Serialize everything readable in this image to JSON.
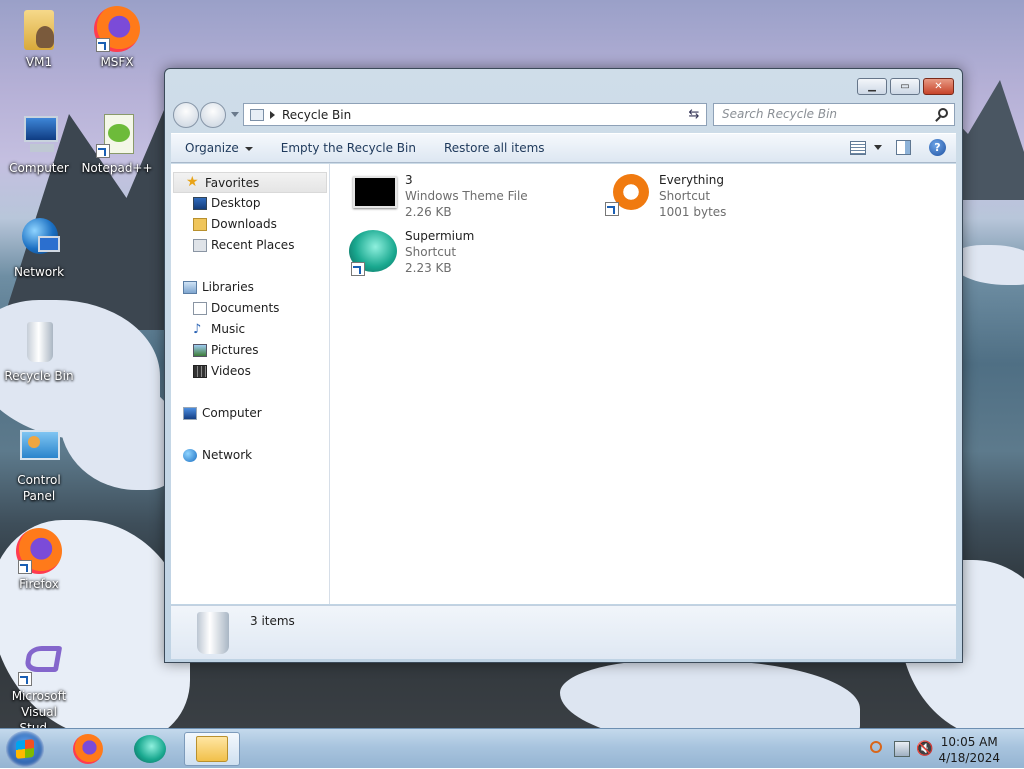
{
  "desktop": {
    "icons": [
      {
        "label": "VM1"
      },
      {
        "label": "MSFX"
      },
      {
        "label": "Computer"
      },
      {
        "label": "Notepad++"
      },
      {
        "label": "Network"
      },
      {
        "label": "Recycle Bin"
      },
      {
        "label": "Control Panel"
      },
      {
        "label": "Firefox"
      },
      {
        "label": "Microsoft Visual Stud..."
      }
    ]
  },
  "window": {
    "address": "Recycle Bin",
    "search_placeholder": "Search Recycle Bin",
    "toolbar": {
      "organize": "Organize",
      "empty": "Empty the Recycle Bin",
      "restore": "Restore all items"
    },
    "nav": {
      "favorites": "Favorites",
      "desktop": "Desktop",
      "downloads": "Downloads",
      "recent": "Recent Places",
      "libraries": "Libraries",
      "documents": "Documents",
      "music": "Music",
      "pictures": "Pictures",
      "videos": "Videos",
      "computer": "Computer",
      "network": "Network"
    },
    "files": [
      {
        "name": "3",
        "type": "Windows Theme File",
        "size": "2.26 KB"
      },
      {
        "name": "Everything",
        "type": "Shortcut",
        "size": "1001 bytes"
      },
      {
        "name": "Supermium",
        "type": "Shortcut",
        "size": "2.23 KB"
      }
    ],
    "status": "3 items"
  },
  "taskbar": {
    "time": "10:05 AM",
    "date": "4/18/2024"
  },
  "colors": {
    "accent": "#1e395b",
    "close_button": "#c7442a",
    "taskbar": "#a8c4de"
  }
}
